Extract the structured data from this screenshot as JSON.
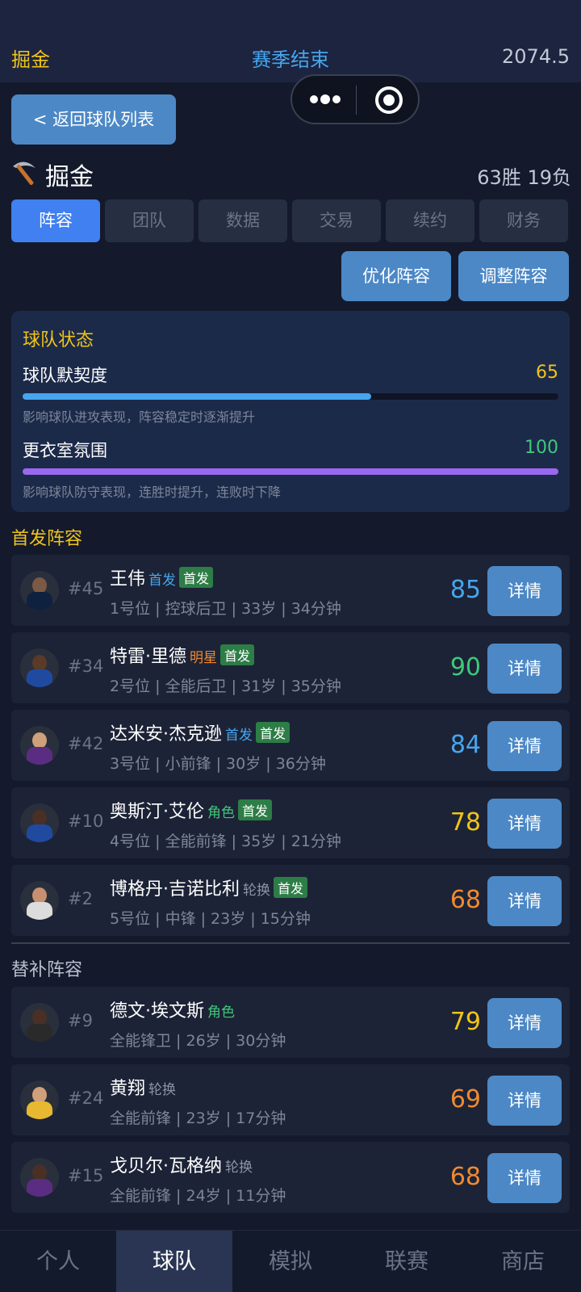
{
  "topbar": {
    "team": "掘金",
    "status": "赛季结束",
    "score": "2074.5"
  },
  "back_button": "< 返回球队列表",
  "team": {
    "name": "掘金",
    "record": "63胜 19负"
  },
  "tabs": [
    "阵容",
    "团队",
    "数据",
    "交易",
    "续约",
    "财务"
  ],
  "actions": {
    "optimize": "优化阵容",
    "adjust": "调整阵容"
  },
  "status": {
    "title": "球队状态",
    "chemistry": {
      "label": "球队默契度",
      "value": "65",
      "level": 0.65,
      "desc": "影响球队进攻表现，阵容稳定时逐渐提升"
    },
    "morale": {
      "label": "更衣室氛围",
      "value": "100",
      "level": 1.0,
      "desc": "影响球队防守表现，连胜时提升，连败时下降"
    }
  },
  "starters_title": "首发阵容",
  "bench_title": "替补阵容",
  "detail_label": "详情",
  "starters": [
    {
      "number": "#45",
      "name": "王伟",
      "role": "首发",
      "badge": "首发",
      "info": "1号位 | 控球后卫 | 33岁 | 34分钟",
      "rating": "85"
    },
    {
      "number": "#34",
      "name": "特雷·里德",
      "role": "明星",
      "badge": "首发",
      "info": "2号位 | 全能后卫 | 31岁 | 35分钟",
      "rating": "90"
    },
    {
      "number": "#42",
      "name": "达米安·杰克逊",
      "role": "首发",
      "badge": "首发",
      "info": "3号位 | 小前锋 | 30岁 | 36分钟",
      "rating": "84"
    },
    {
      "number": "#10",
      "name": "奥斯汀·艾伦",
      "role": "角色",
      "badge": "首发",
      "info": "4号位 | 全能前锋 | 35岁 | 21分钟",
      "rating": "78"
    },
    {
      "number": "#2",
      "name": "博格丹·吉诺比利",
      "role": "轮换",
      "badge": "首发",
      "info": "5号位 | 中锋 | 23岁 | 15分钟",
      "rating": "68"
    }
  ],
  "bench": [
    {
      "number": "#9",
      "name": "德文·埃文斯",
      "role": "角色",
      "info": "全能锋卫 | 26岁 | 30分钟",
      "rating": "79"
    },
    {
      "number": "#24",
      "name": "黄翔",
      "role": "轮换",
      "info": "全能前锋 | 23岁 | 17分钟",
      "rating": "69"
    },
    {
      "number": "#15",
      "name": "戈贝尔·瓦格纳",
      "role": "轮换",
      "info": "全能前锋 | 24岁 | 11分钟",
      "rating": "68"
    }
  ],
  "nav": [
    "个人",
    "球队",
    "模拟",
    "联赛",
    "商店"
  ],
  "colors": {
    "accent_gold": "#f0c419",
    "accent_blue": "#46a6ee",
    "tab_active": "#4080f0",
    "button": "#4c88c6",
    "rating_high": "#3ec97a",
    "rating_mid_high": "#46a6ee",
    "rating_mid": "#f0c419",
    "rating_low": "#f08a30",
    "role_star": "#f08a30",
    "role_starter": "#46a6ee",
    "role_role": "#3ec97a",
    "role_rotation": "#8a93a6"
  }
}
